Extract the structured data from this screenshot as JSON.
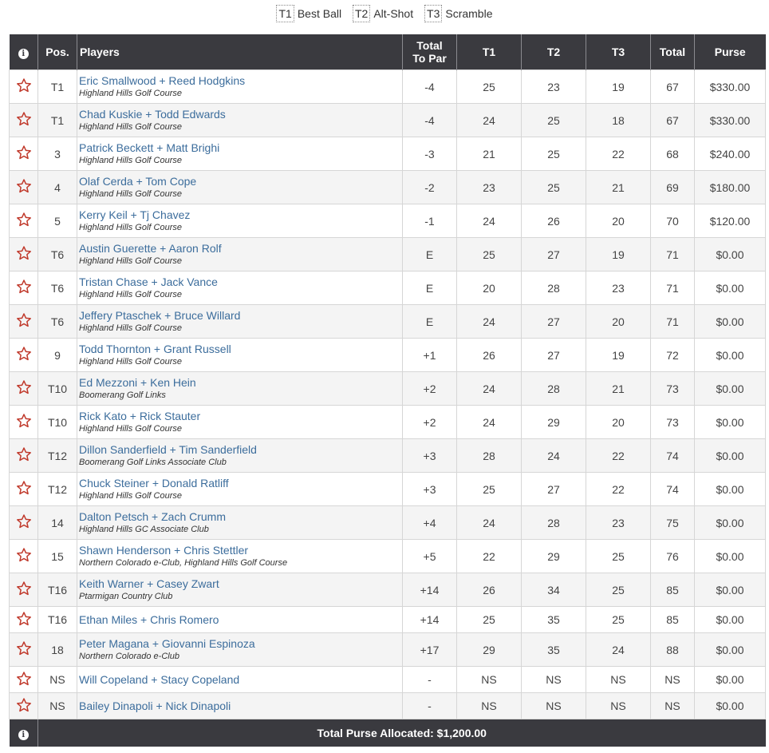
{
  "legend": [
    {
      "key": "T1",
      "label": "Best Ball"
    },
    {
      "key": "T2",
      "label": "Alt-Shot"
    },
    {
      "key": "T3",
      "label": "Scramble"
    }
  ],
  "headers": {
    "pos": "Pos.",
    "players": "Players",
    "to_par_line1": "Total",
    "to_par_line2": "To Par",
    "t1": "T1",
    "t2": "T2",
    "t3": "T3",
    "total": "Total",
    "purse": "Purse"
  },
  "rows": [
    {
      "pos": "T1",
      "names": "Eric Smallwood + Reed Hodgkins",
      "club": "Highland Hills Golf Course",
      "to_par": "-4",
      "t1": "25",
      "t2": "23",
      "t3": "19",
      "total": "67",
      "purse": "$330.00"
    },
    {
      "pos": "T1",
      "names": "Chad Kuskie + Todd Edwards",
      "club": "Highland Hills Golf Course",
      "to_par": "-4",
      "t1": "24",
      "t2": "25",
      "t3": "18",
      "total": "67",
      "purse": "$330.00"
    },
    {
      "pos": "3",
      "names": "Patrick Beckett + Matt Brighi",
      "club": "Highland Hills Golf Course",
      "to_par": "-3",
      "t1": "21",
      "t2": "25",
      "t3": "22",
      "total": "68",
      "purse": "$240.00"
    },
    {
      "pos": "4",
      "names": "Olaf Cerda + Tom Cope",
      "club": "Highland Hills Golf Course",
      "to_par": "-2",
      "t1": "23",
      "t2": "25",
      "t3": "21",
      "total": "69",
      "purse": "$180.00"
    },
    {
      "pos": "5",
      "names": "Kerry Keil + Tj Chavez",
      "club": "Highland Hills Golf Course",
      "to_par": "-1",
      "t1": "24",
      "t2": "26",
      "t3": "20",
      "total": "70",
      "purse": "$120.00"
    },
    {
      "pos": "T6",
      "names": "Austin Guerette + Aaron Rolf",
      "club": "Highland Hills Golf Course",
      "to_par": "E",
      "t1": "25",
      "t2": "27",
      "t3": "19",
      "total": "71",
      "purse": "$0.00"
    },
    {
      "pos": "T6",
      "names": "Tristan Chase + Jack Vance",
      "club": "Highland Hills Golf Course",
      "to_par": "E",
      "t1": "20",
      "t2": "28",
      "t3": "23",
      "total": "71",
      "purse": "$0.00"
    },
    {
      "pos": "T6",
      "names": "Jeffery Ptaschek + Bruce Willard",
      "club": "Highland Hills Golf Course",
      "to_par": "E",
      "t1": "24",
      "t2": "27",
      "t3": "20",
      "total": "71",
      "purse": "$0.00"
    },
    {
      "pos": "9",
      "names": "Todd Thornton + Grant Russell",
      "club": "Highland Hills Golf Course",
      "to_par": "+1",
      "t1": "26",
      "t2": "27",
      "t3": "19",
      "total": "72",
      "purse": "$0.00"
    },
    {
      "pos": "T10",
      "names": "Ed Mezzoni + Ken Hein",
      "club": "Boomerang Golf Links",
      "to_par": "+2",
      "t1": "24",
      "t2": "28",
      "t3": "21",
      "total": "73",
      "purse": "$0.00"
    },
    {
      "pos": "T10",
      "names": "Rick Kato + Rick Stauter",
      "club": "Highland Hills Golf Course",
      "to_par": "+2",
      "t1": "24",
      "t2": "29",
      "t3": "20",
      "total": "73",
      "purse": "$0.00"
    },
    {
      "pos": "T12",
      "names": "Dillon Sanderfield + Tim Sanderfield",
      "club": "Boomerang Golf Links Associate Club",
      "to_par": "+3",
      "t1": "28",
      "t2": "24",
      "t3": "22",
      "total": "74",
      "purse": "$0.00"
    },
    {
      "pos": "T12",
      "names": "Chuck Steiner + Donald Ratliff",
      "club": "Highland Hills Golf Course",
      "to_par": "+3",
      "t1": "25",
      "t2": "27",
      "t3": "22",
      "total": "74",
      "purse": "$0.00"
    },
    {
      "pos": "14",
      "names": "Dalton Petsch + Zach Crumm",
      "club": "Highland Hills GC Associate Club",
      "to_par": "+4",
      "t1": "24",
      "t2": "28",
      "t3": "23",
      "total": "75",
      "purse": "$0.00"
    },
    {
      "pos": "15",
      "names": "Shawn Henderson + Chris Stettler",
      "club": "Northern Colorado e-Club, Highland Hills Golf Course",
      "to_par": "+5",
      "t1": "22",
      "t2": "29",
      "t3": "25",
      "total": "76",
      "purse": "$0.00"
    },
    {
      "pos": "T16",
      "names": "Keith Warner + Casey Zwart",
      "club": "Ptarmigan Country Club",
      "to_par": "+14",
      "t1": "26",
      "t2": "34",
      "t3": "25",
      "total": "85",
      "purse": "$0.00"
    },
    {
      "pos": "T16",
      "names": "Ethan Miles + Chris Romero",
      "club": "",
      "to_par": "+14",
      "t1": "25",
      "t2": "35",
      "t3": "25",
      "total": "85",
      "purse": "$0.00"
    },
    {
      "pos": "18",
      "names": "Peter Magana + Giovanni Espinoza",
      "club": "Northern Colorado e-Club",
      "to_par": "+17",
      "t1": "29",
      "t2": "35",
      "t3": "24",
      "total": "88",
      "purse": "$0.00"
    },
    {
      "pos": "NS",
      "names": "Will Copeland + Stacy Copeland",
      "club": "",
      "to_par": "-",
      "t1": "NS",
      "t2": "NS",
      "t3": "NS",
      "total": "NS",
      "purse": "$0.00"
    },
    {
      "pos": "NS",
      "names": "Bailey Dinapoli + Nick Dinapoli",
      "club": "",
      "to_par": "-",
      "t1": "NS",
      "t2": "NS",
      "t3": "NS",
      "total": "NS",
      "purse": "$0.00"
    }
  ],
  "footer": {
    "total_purse": "Total Purse Allocated: $1,200.00"
  },
  "colors": {
    "header_bg": "#3a3a3f",
    "link": "#3c6d9c",
    "star": "#c0392b"
  },
  "icons": {
    "info": "info-icon",
    "favorite": "star-outline-icon"
  }
}
